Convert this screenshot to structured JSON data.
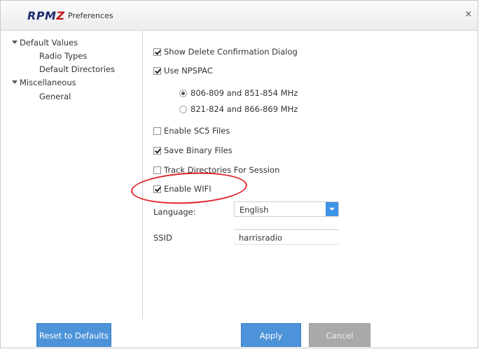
{
  "window": {
    "logo_text": "RPM",
    "logo_z": "Z",
    "title": "Preferences",
    "close_glyph": "×"
  },
  "tree": [
    {
      "label": "Default Values",
      "expanded": true
    },
    {
      "label": "Radio Types"
    },
    {
      "label": "Default Directories"
    },
    {
      "label": "Miscellaneous",
      "expanded": true
    },
    {
      "label": "General",
      "selected": true
    }
  ],
  "settings": {
    "show_delete_confirmation": {
      "label": "Show Delete Confirmation Dialog",
      "checked": true
    },
    "use_npspac": {
      "label": "Use NPSPAC",
      "checked": true
    },
    "band_806": {
      "label": "806-809 and 851-854 MHz",
      "selected": true
    },
    "band_821": {
      "label": "821-824 and 866-869 MHz",
      "selected": false
    },
    "enable_sc5": {
      "label": "Enable SC5 Files",
      "checked": false
    },
    "save_binary": {
      "label": "Save Binary Files",
      "checked": true
    },
    "track_directories": {
      "label": "Track Directories For Session",
      "checked": false
    },
    "enable_wifi": {
      "label": "Enable WIFI",
      "checked": true
    },
    "language": {
      "label": "Language:",
      "value": "English"
    },
    "ssid": {
      "label": "SSID",
      "value": "harrisradio"
    }
  },
  "buttons": {
    "reset": "Reset to Defaults",
    "apply": "Apply",
    "cancel": "Cancel"
  },
  "colors": {
    "accent": "#4d93d9",
    "annotation": "#e0232a",
    "logo_blue": "#1c2b6e",
    "logo_red": "#c4161c"
  }
}
